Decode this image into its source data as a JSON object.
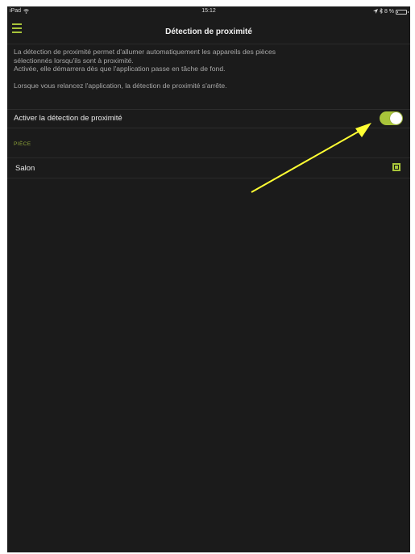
{
  "status_bar": {
    "carrier": "iPad",
    "time": "15:12",
    "battery_text": "8 %"
  },
  "nav": {
    "title": "Détection de proximité",
    "menu_icon": "hamburger-menu-icon"
  },
  "description": {
    "line1": "La détection de proximité permet d'allumer automatiquement les appareils des pièces",
    "line2": "sélectionnés lorsqu'ils sont à proximité.",
    "line3": "Activée, elle démarrera dès que l'application passe en tâche de fond.",
    "note": "Lorsque vous relancez l'application, la détection de proximité s'arrête."
  },
  "toggle": {
    "label": "Activer la détection de proximité",
    "state": "on"
  },
  "section": {
    "header": "PIÈCE"
  },
  "rooms": [
    {
      "label": "Salon",
      "checked": true
    }
  ],
  "colors": {
    "accent": "#a8c43a",
    "background": "#1b1b1b",
    "annotation_arrow": "#ffff33"
  },
  "annotation": {
    "icon": "yellow-arrow-pointing-to-toggle"
  }
}
